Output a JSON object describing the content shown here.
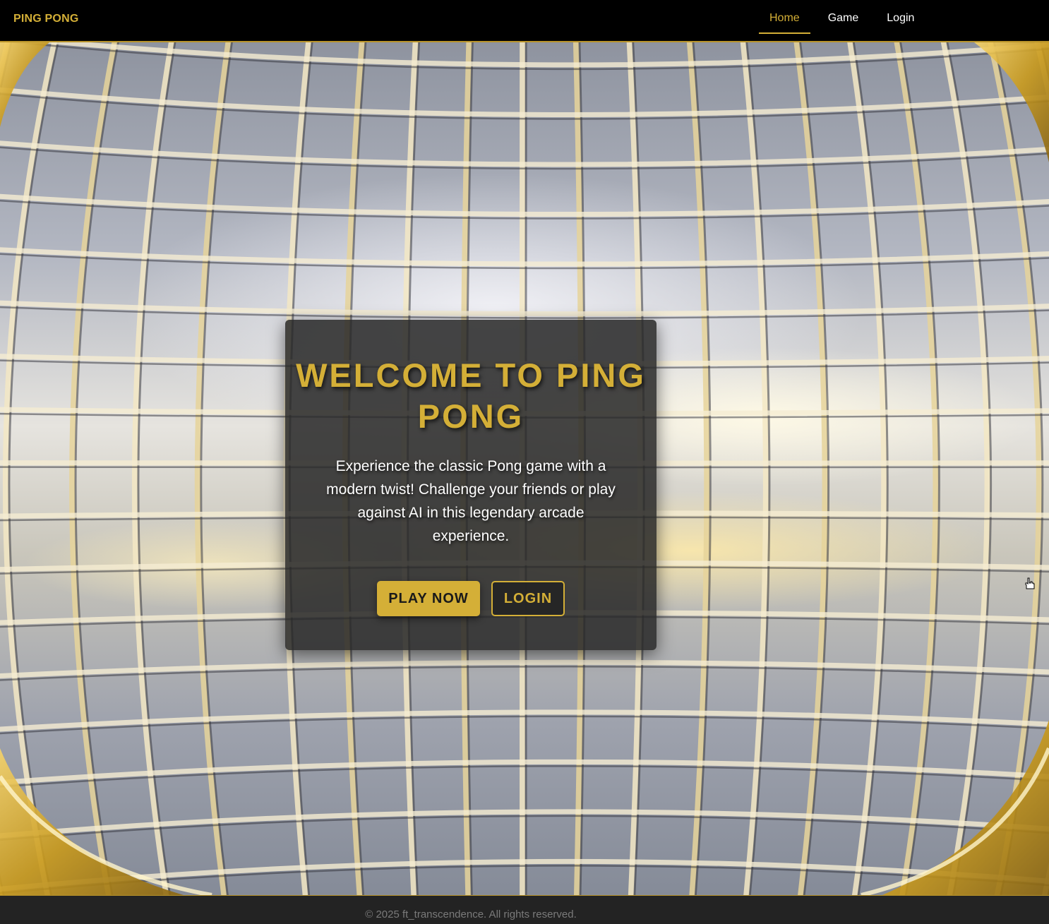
{
  "navbar": {
    "brand": "PING PONG",
    "links": [
      {
        "label": "Home",
        "active": true
      },
      {
        "label": "Game",
        "active": false
      },
      {
        "label": "Login",
        "active": false
      }
    ]
  },
  "hero": {
    "background": "tennis-racket-strings-photo"
  },
  "card": {
    "title": "WELCOME TO PING PONG",
    "description": "Experience the classic Pong game with a modern twist! Challenge your friends or play against AI in this legendary arcade experience.",
    "play_label": "PLAY NOW",
    "login_label": "LOGIN"
  },
  "footer": {
    "text": "© 2025 ft_transcendence. All rights reserved."
  },
  "theme": {
    "accent": "#d4af37",
    "navbar_bg": "#000000",
    "card_bg": "#282828"
  }
}
